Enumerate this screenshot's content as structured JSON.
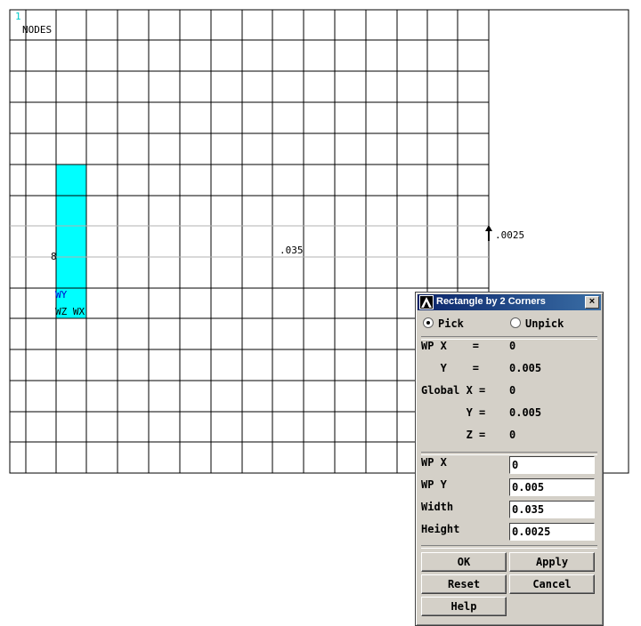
{
  "graphics": {
    "window_number": "1",
    "nodes_label": "NODES",
    "width_label": ".035",
    "height_label": ".0025",
    "wp_y_label": "WY",
    "wp_zx_label": "WZ WX",
    "wp_origin_label": "8",
    "colors": {
      "grid": "#000000",
      "rectangle": "#00ffff",
      "wp_label": "#0000cc",
      "window_number": "#00c8c8"
    }
  },
  "dialog": {
    "title": "Rectangle by 2 Corners",
    "close_label": "×",
    "pick_label": "Pick",
    "unpick_label": "Unpick",
    "pick_selected": true,
    "info": {
      "wp_x_label": "WP X    =",
      "wp_x_value": "0",
      "wp_y_label": "   Y    =",
      "wp_y_value": "0.005",
      "global_x_label": "Global X =",
      "global_x_value": "0",
      "global_y_label": "       Y =",
      "global_y_value": "0.005",
      "global_z_label": "       Z =",
      "global_z_value": "0"
    },
    "fields": {
      "wp_x_label": "WP X",
      "wp_x_value": "0",
      "wp_y_label": "WP Y",
      "wp_y_value": "0.005",
      "width_label": "Width",
      "width_value": "0.035",
      "height_label": "Height",
      "height_value": "0.0025"
    },
    "buttons": {
      "ok": "OK",
      "apply": "Apply",
      "reset": "Reset",
      "cancel": "Cancel",
      "help": "Help"
    }
  }
}
